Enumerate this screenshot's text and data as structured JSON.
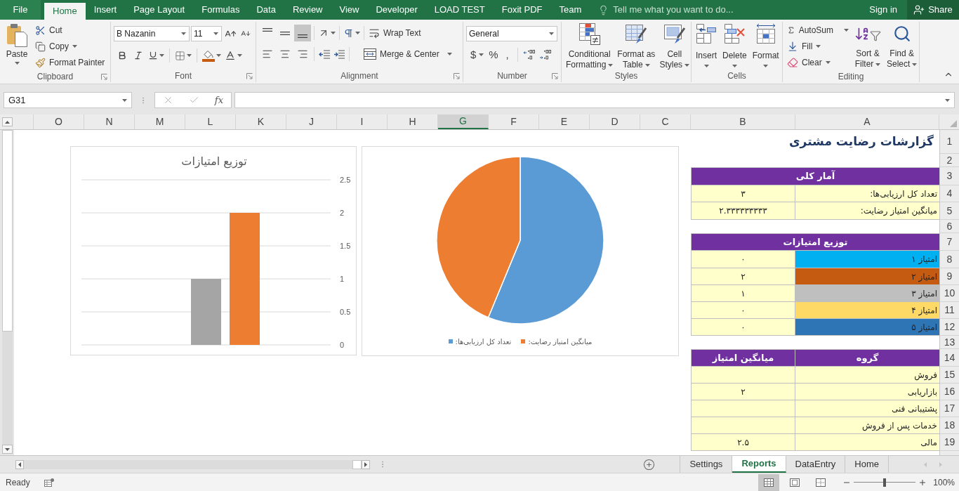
{
  "title_bar": {
    "tabs": [
      {
        "label": "File",
        "selected": false,
        "kind": "file_menu"
      },
      {
        "label": "Home",
        "selected": true,
        "kind": "tab"
      },
      {
        "label": "Insert",
        "selected": false,
        "kind": "tab"
      },
      {
        "label": "Page Layout",
        "selected": false,
        "kind": "tab"
      },
      {
        "label": "Formulas",
        "selected": false,
        "kind": "tab"
      },
      {
        "label": "Data",
        "selected": false,
        "kind": "tab"
      },
      {
        "label": "Review",
        "selected": false,
        "kind": "tab"
      },
      {
        "label": "View",
        "selected": false,
        "kind": "tab"
      },
      {
        "label": "Developer",
        "selected": false,
        "kind": "tab"
      },
      {
        "label": "LOAD TEST",
        "selected": false,
        "kind": "tab"
      },
      {
        "label": "Foxit PDF",
        "selected": false,
        "kind": "tab"
      },
      {
        "label": "Team",
        "selected": false,
        "kind": "tab"
      }
    ],
    "tell_me": {
      "placeholder": "Tell me what you want to do..."
    },
    "sign_in": "Sign in",
    "share": "Share"
  },
  "ribbon": {
    "clipboard": {
      "label": "Clipboard",
      "paste": "Paste",
      "cut": "Cut",
      "copy": "Copy",
      "format_painter": "Format Painter"
    },
    "font": {
      "label": "Font",
      "font_name": "B Nazanin",
      "font_size": "11"
    },
    "alignment": {
      "label": "Alignment",
      "vertical": [
        {
          "kind": "top",
          "selected": false
        },
        {
          "kind": "middle",
          "selected": false
        },
        {
          "kind": "bottom",
          "selected": true
        }
      ],
      "horizontal": [
        {
          "kind": "left",
          "selected": false
        },
        {
          "kind": "center",
          "selected": false
        },
        {
          "kind": "right",
          "selected": false
        }
      ],
      "wrap_text": "Wrap Text",
      "merge_center": "Merge & Center"
    },
    "number": {
      "label": "Number",
      "format": "General",
      "symbols": [
        {
          "kind": "currency",
          "glyph": "$"
        },
        {
          "kind": "percent",
          "glyph": "%"
        },
        {
          "kind": "comma",
          "glyph": ","
        }
      ]
    },
    "styles": {
      "label": "Styles",
      "buttons": [
        {
          "kind": "conditional",
          "lines": [
            "Conditional",
            "Formatting"
          ]
        },
        {
          "kind": "table",
          "lines": [
            "Format as",
            "Table"
          ]
        },
        {
          "kind": "cell",
          "lines": [
            "Cell",
            "Styles"
          ]
        }
      ]
    },
    "cells": {
      "label": "Cells",
      "buttons": [
        {
          "kind": "insert",
          "label": "Insert"
        },
        {
          "kind": "delete",
          "label": "Delete"
        },
        {
          "kind": "format",
          "label": "Format"
        }
      ]
    },
    "editing": {
      "label": "Editing",
      "small": [
        {
          "kind": "autosum",
          "label": "AutoSum"
        },
        {
          "kind": "fill",
          "label": "Fill"
        },
        {
          "kind": "clear",
          "label": "Clear"
        }
      ],
      "large": [
        {
          "kind": "sort",
          "lines": [
            "Sort &",
            "Filter"
          ]
        },
        {
          "kind": "find",
          "lines": [
            "Find &",
            "Select"
          ]
        }
      ]
    }
  },
  "formula_bar": {
    "name_box": "G31",
    "function_label": "fx"
  },
  "sheet": {
    "columns": [
      {
        "label": "O",
        "selected": false
      },
      {
        "label": "N",
        "selected": false
      },
      {
        "label": "M",
        "selected": false
      },
      {
        "label": "L",
        "selected": false
      },
      {
        "label": "K",
        "selected": false
      },
      {
        "label": "J",
        "selected": false
      },
      {
        "label": "I",
        "selected": false
      },
      {
        "label": "H",
        "selected": false
      },
      {
        "label": "G",
        "selected": true
      },
      {
        "label": "F",
        "selected": false
      },
      {
        "label": "E",
        "selected": false
      },
      {
        "label": "D",
        "selected": false
      },
      {
        "label": "C",
        "selected": false
      },
      {
        "label": "B",
        "selected": false
      },
      {
        "label": "A",
        "selected": false
      }
    ],
    "rows": [
      "1",
      "2",
      "3",
      "4",
      "5",
      "6",
      "7",
      "8",
      "9",
      "10",
      "11",
      "12",
      "13",
      "14",
      "15",
      "16",
      "17",
      "18",
      "19"
    ],
    "title": "گزارشات رضایت مشتری",
    "summary": {
      "header": "آمار کلی",
      "rows": [
        {
          "label": "تعداد کل ارزیابی‌ها:",
          "value": "۳"
        },
        {
          "label": "میانگین امتیاز رضایت:",
          "value": "۲.۳۳۳۳۳۳۳۳۳"
        }
      ]
    },
    "distribution": {
      "header": "توزیع امتیازات",
      "rows": [
        {
          "label": "امتیاز ۱",
          "value": "۰",
          "color": "#00b0f0"
        },
        {
          "label": "امتیاز ۲",
          "value": "۲",
          "color": "#c55a11"
        },
        {
          "label": "امتیاز ۳",
          "value": "۱",
          "color": "#bfbfbf"
        },
        {
          "label": "امتیاز ۴",
          "value": "۰",
          "color": "#ffd966"
        },
        {
          "label": "امتیاز ۵",
          "value": "۰",
          "color": "#2e75b6"
        }
      ]
    },
    "groups": {
      "columns": [
        "گروه",
        "میانگین امتیاز"
      ],
      "rows": [
        {
          "group": "فروش"
        },
        {
          "group": "بازاریابی",
          "value": "۲"
        },
        {
          "group": "پشتیبانی فنی"
        },
        {
          "group": "خدمات پس از فروش"
        },
        {
          "group": "مالی",
          "value": "۲.۵"
        }
      ]
    }
  },
  "bar_chart": {
    "chart_data": {
      "type": "bar",
      "title": "توزیع امتیازات",
      "series": [
        {
          "values": [
            0
          ]
        },
        {
          "color": "#ed7d31",
          "values": [
            2
          ]
        },
        {
          "color": "#a5a5a5",
          "values": [
            1
          ]
        },
        {
          "values": [
            0
          ]
        },
        {
          "values": [
            0
          ]
        }
      ],
      "ylim": [
        0,
        2.5
      ],
      "yticks": [
        0,
        0.5,
        1,
        1.5,
        2,
        2.5
      ],
      "grid": true
    }
  },
  "pie_chart": {
    "legend": [
      {
        "label": "میانگین امتیاز رضایت:",
        "color": "#ed7d31"
      },
      {
        "label": "تعداد کل ارزیابی‌ها:",
        "color": "#5b9bd5"
      }
    ]
  },
  "sheet_tabs": [
    {
      "label": "Settings",
      "selected": false
    },
    {
      "label": "Reports",
      "selected": true
    },
    {
      "label": "DataEntry",
      "selected": false
    },
    {
      "label": "Home",
      "selected": false
    }
  ],
  "status_bar": {
    "status": "Ready",
    "views": [
      {
        "kind": "normal",
        "selected": true
      },
      {
        "kind": "page_layout",
        "selected": false
      },
      {
        "kind": "page_break",
        "selected": false
      }
    ],
    "zoom": {
      "level": 0.5,
      "reading": "100%"
    }
  }
}
